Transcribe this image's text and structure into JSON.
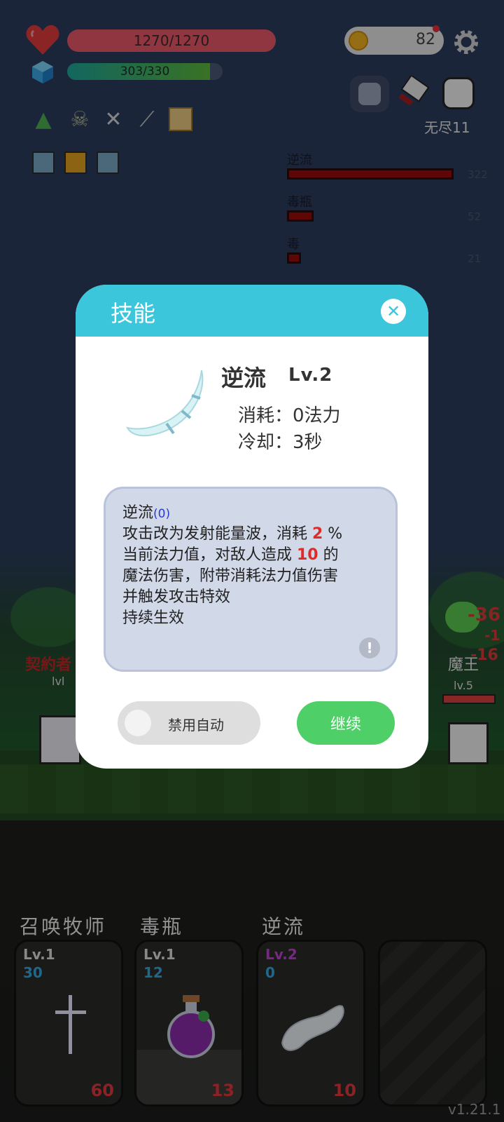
{
  "hud": {
    "hp_text": "1270/1270",
    "hp_fraction": 1.0,
    "mp_text": "303/330",
    "mp_fraction": 0.918,
    "coins": "82",
    "mode_label": "无尽11",
    "colors": {
      "hp": "#e8576a",
      "mp": "#2fa86a",
      "accent": "#3bc6dc",
      "continue": "#4fcf68"
    }
  },
  "damage_stats": [
    {
      "label": "逆流",
      "value": "322"
    },
    {
      "label": "毒瓶",
      "value": "52"
    },
    {
      "label": "毒",
      "value": "21"
    }
  ],
  "scene": {
    "left_unit_name": "契約者",
    "left_unit_level": "lvl",
    "right_unit_name": "魔王",
    "right_unit_level": "lv.5",
    "floating_damage": [
      "-36",
      "-1",
      "-16"
    ]
  },
  "dialog": {
    "title": "技能",
    "close_icon": "close-icon",
    "skill_name": "逆流",
    "skill_level": "Lv.2",
    "cost": "消耗：0法力",
    "cooldown": "冷却：3秒",
    "desc_title": "逆流",
    "desc_title_count": "(0)",
    "desc_line1_a": "攻击改为发射能量波，消耗 ",
    "desc_line1_num": "2",
    "desc_line1_b": " %",
    "desc_line2_a": "当前法力值，对敌人造成 ",
    "desc_line2_num": "10",
    "desc_line2_b": " 的",
    "desc_line3": "魔法伤害，附带消耗法力值伤害",
    "desc_line4": "并触发攻击特效",
    "desc_line5": "持续生效",
    "toggle_label": "禁用自动",
    "continue_label": "继续"
  },
  "cards": [
    {
      "title": "召唤牧师",
      "level": "Lv.1",
      "cost": "30",
      "count": "60",
      "icon": "cross-icon"
    },
    {
      "title": "毒瓶",
      "level": "Lv.1",
      "cost": "12",
      "count": "13",
      "icon": "potion-icon"
    },
    {
      "title": "逆流",
      "level": "Lv.2",
      "cost": "0",
      "count": "10",
      "icon": "wing-icon"
    },
    {
      "title": "",
      "level": "",
      "cost": "",
      "count": "",
      "icon": "empty-slot"
    }
  ],
  "version": "v1.21.1"
}
